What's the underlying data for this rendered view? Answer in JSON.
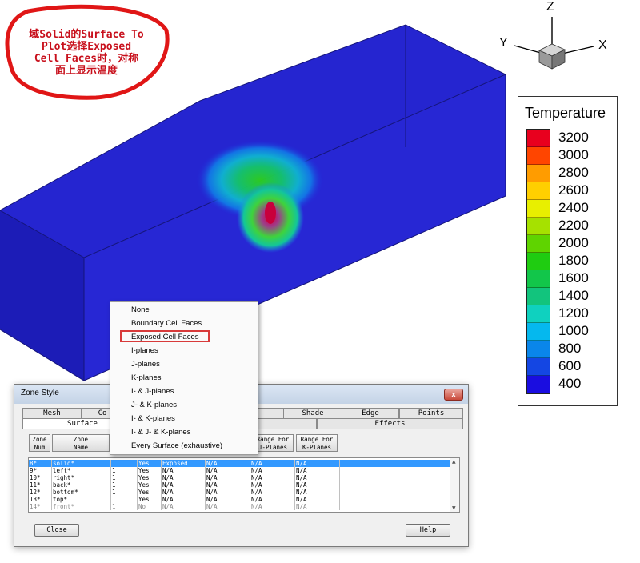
{
  "annotation": {
    "lines": [
      "域Solid的Surface To",
      "Plot选择Exposed",
      "Cell Faces时，对称",
      "面上显示温度"
    ],
    "color": "#c8101c"
  },
  "axes_triad": {
    "z": "Z",
    "y": "Y",
    "x": "X"
  },
  "legend": {
    "title": "Temperature",
    "labels": [
      "3200",
      "3000",
      "2800",
      "2600",
      "2400",
      "2200",
      "2000",
      "1800",
      "1600",
      "1400",
      "1200",
      "1000",
      "800",
      "600",
      "400"
    ],
    "colors": [
      "#e8001e",
      "#ff4500",
      "#ff9c00",
      "#ffcf00",
      "#e8ef00",
      "#a6e100",
      "#5fd400",
      "#1fcc11",
      "#12c64a",
      "#12c47d",
      "#0fd1bf",
      "#05b8ee",
      "#0a86ea",
      "#1446e3",
      "#1a0de0"
    ]
  },
  "zone_style": {
    "title": "Zone Style",
    "close_glyph": "x",
    "tabs_row1": [
      "Mesh",
      "Co",
      "",
      "Shade",
      "Edge",
      "Points"
    ],
    "tabs_row2": [
      "Surface",
      "",
      "Effects"
    ],
    "columns": [
      [
        "Zone",
        "Num"
      ],
      [
        "Zone",
        "Name"
      ],
      [
        "Range For",
        "J-Planes"
      ],
      [
        "Range For",
        "K-Planes"
      ]
    ],
    "rows": [
      [
        "8*",
        "solid*",
        "1",
        "Yes",
        "Exposed",
        "N/A",
        "N/A",
        "N/A"
      ],
      [
        "9*",
        "left*",
        "1",
        "Yes",
        "N/A",
        "N/A",
        "N/A",
        "N/A"
      ],
      [
        "10*",
        "right*",
        "1",
        "Yes",
        "N/A",
        "N/A",
        "N/A",
        "N/A"
      ],
      [
        "11*",
        "back*",
        "1",
        "Yes",
        "N/A",
        "N/A",
        "N/A",
        "N/A"
      ],
      [
        "12*",
        "bottom*",
        "1",
        "Yes",
        "N/A",
        "N/A",
        "N/A",
        "N/A"
      ],
      [
        "13*",
        "top*",
        "1",
        "Yes",
        "N/A",
        "N/A",
        "N/A",
        "N/A"
      ],
      [
        "14*",
        "front*",
        "1",
        "No",
        "N/A",
        "N/A",
        "N/A",
        "N/A"
      ]
    ],
    "close_button": "Close",
    "help_button": "Help"
  },
  "surface_menu": {
    "items": [
      "None",
      "Boundary Cell Faces",
      "Exposed Cell Faces",
      "I-planes",
      "J-planes",
      "K-planes",
      "I- & J-planes",
      "J- & K-planes",
      "I- & K-planes",
      "I- & J- & K-planes",
      "Every Surface (exhaustive)"
    ],
    "highlighted": "Exposed Cell Faces"
  }
}
